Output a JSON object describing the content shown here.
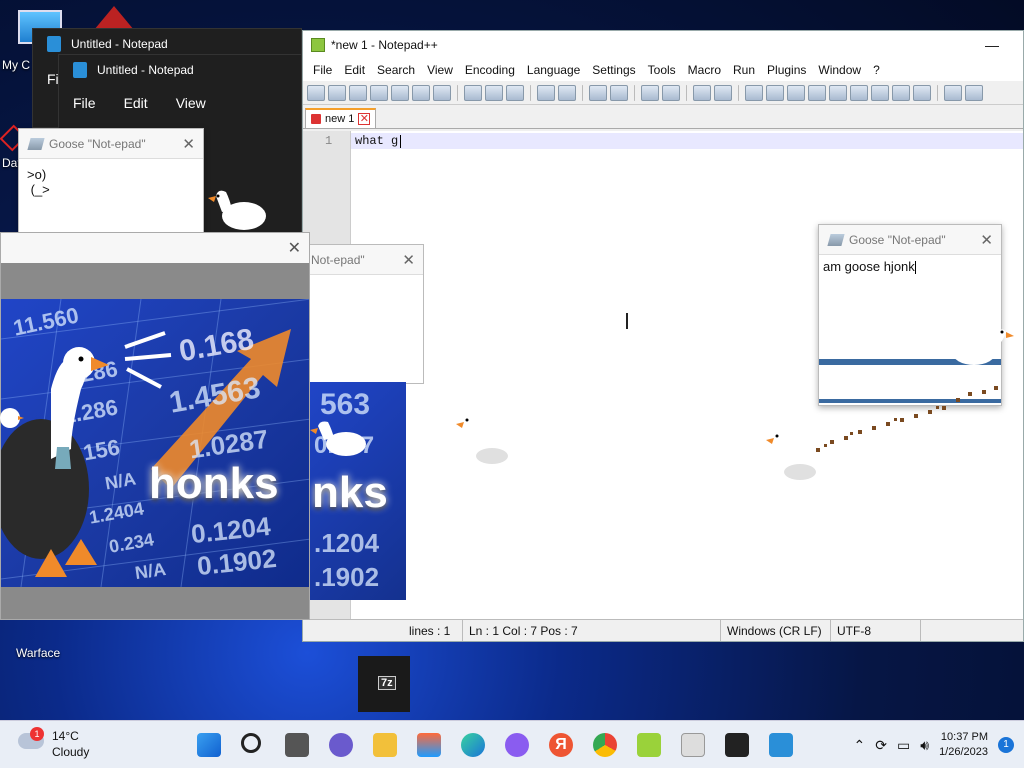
{
  "desktop": {
    "icons": [
      {
        "label": "My C"
      },
      {
        "label": "Dat"
      },
      {
        "label": "Warface"
      }
    ]
  },
  "notepad_back": {
    "title": "Untitled - Notepad",
    "menu_partial": "Fil"
  },
  "notepad_front": {
    "title": "Untitled - Notepad",
    "menu": [
      "File",
      "Edit",
      "View"
    ]
  },
  "npp": {
    "title": "*new 1 - Notepad++",
    "menu": [
      "File",
      "Edit",
      "Search",
      "View",
      "Encoding",
      "Language",
      "Settings",
      "Tools",
      "Macro",
      "Run",
      "Plugins",
      "Window",
      "?"
    ],
    "tab_label": "new 1",
    "line_number": "1",
    "text": "what g",
    "status": {
      "lines": "lines : 1",
      "position": "Ln : 1    Col : 7    Pos : 7",
      "eol": "Windows (CR LF)",
      "encoding": "UTF-8"
    }
  },
  "goose_note_left": {
    "title": "Goose \"Not-epad\"",
    "line1": ">o)",
    "line2": " (_>"
  },
  "goose_note_right": {
    "title": "Goose \"Not-epad\"",
    "text": "am goose hjonk"
  },
  "goose_note_back": {
    "title": "Not-epad\""
  },
  "meme": {
    "numbers": [
      "11.560",
      "0.168",
      "286",
      "1.4563",
      "1.286",
      "1.156",
      "1.0287",
      "N/A",
      "1.2404",
      "0.1204",
      "0.234",
      "0.1902",
      "N/A"
    ],
    "text": "honks",
    "text_partial": "nks",
    "numbers2": [
      "563",
      "0.287",
      ".1204",
      ".1902"
    ]
  },
  "small_window": {
    "label": "7z"
  },
  "taskbar": {
    "weather_temp": "14°C",
    "weather_desc": "Cloudy",
    "weather_badge": "1",
    "time": "10:37 PM",
    "date": "1/26/2023",
    "notif_count": "1",
    "yandex": "Я"
  }
}
